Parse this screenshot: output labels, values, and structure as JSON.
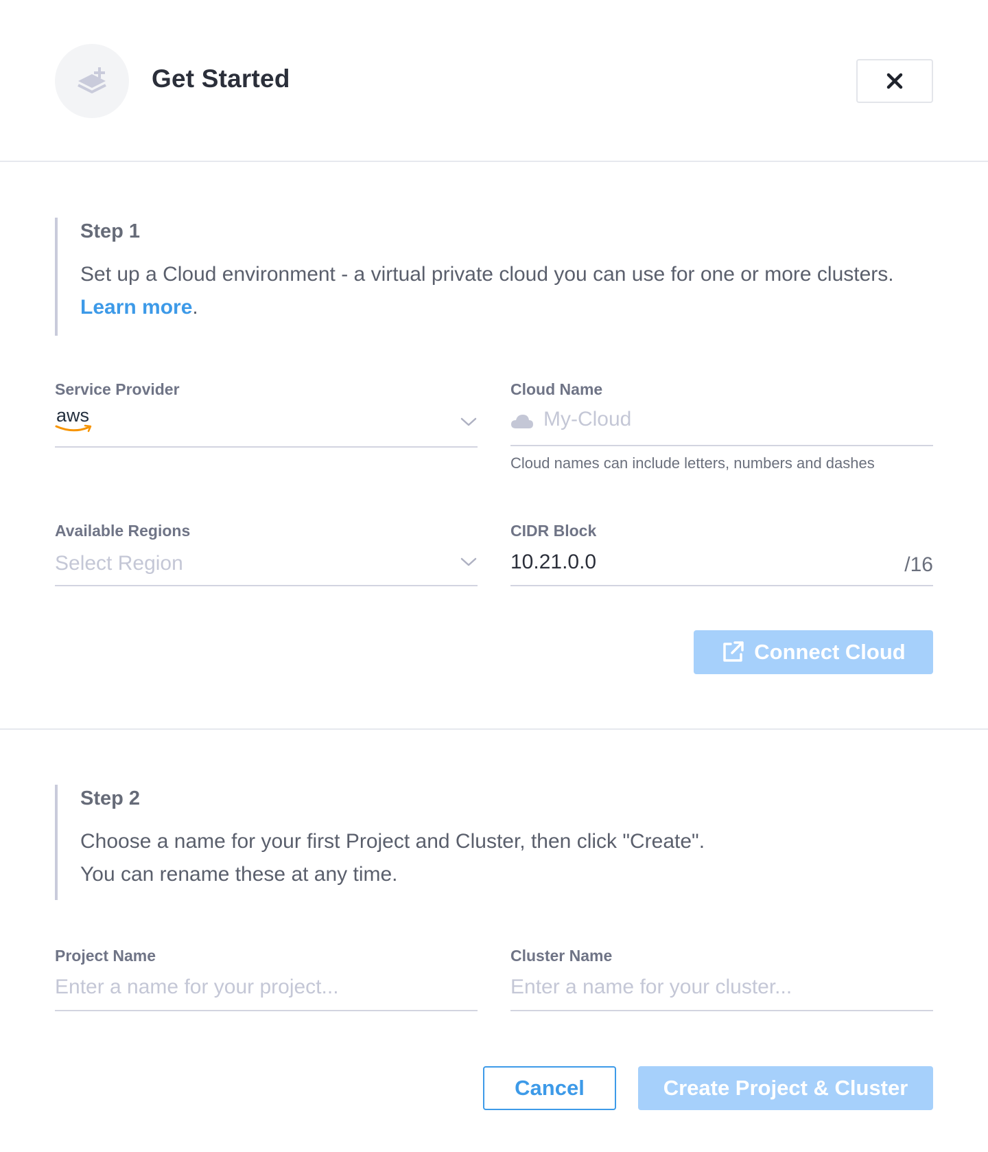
{
  "header": {
    "title": "Get Started",
    "icon": "layers-plus-icon",
    "close_icon": "close-icon"
  },
  "step1": {
    "title": "Step 1",
    "description": "Set up a Cloud environment - a virtual private cloud you can use for one or more clusters.",
    "link_label": "Learn more",
    "link_suffix": "."
  },
  "service_provider": {
    "label": "Service Provider",
    "value": "aws"
  },
  "cloud_name": {
    "label": "Cloud Name",
    "placeholder": "My-Cloud",
    "hint": "Cloud names can include letters, numbers and dashes"
  },
  "regions": {
    "label": "Available Regions",
    "placeholder": "Select Region"
  },
  "cidr": {
    "label": "CIDR Block",
    "value": "10.21.0.0",
    "suffix": "/16"
  },
  "connect_button": {
    "label": "Connect Cloud",
    "icon": "external-link-icon"
  },
  "step2": {
    "title": "Step 2",
    "description_line1": "Choose a name for your first Project and Cluster, then click \"Create\".",
    "description_line2": "You can rename these at any time."
  },
  "project_name": {
    "label": "Project Name",
    "placeholder": "Enter a name for your project..."
  },
  "cluster_name": {
    "label": "Cluster Name",
    "placeholder": "Enter a name for your cluster..."
  },
  "actions": {
    "cancel_label": "Cancel",
    "create_label": "Create Project & Cluster"
  },
  "colors": {
    "accent": "#3d9ae8",
    "primary_disabled": "#a6d0fb",
    "aws_orange": "#f79400"
  }
}
